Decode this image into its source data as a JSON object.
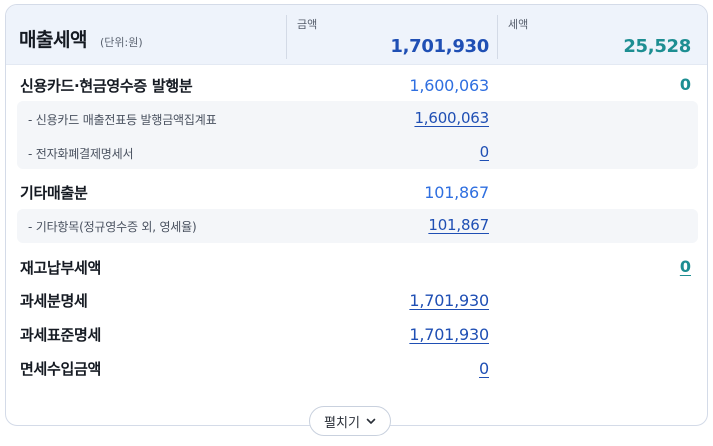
{
  "header": {
    "title": "매출세액",
    "unit": "(단위:원)",
    "amount_label": "금액",
    "amount_value": "1,701,930",
    "tax_label": "세액",
    "tax_value": "25,528"
  },
  "rows": {
    "card_cash": {
      "label": "신용카드·현금영수증 발행분",
      "amount": "1,600,063",
      "tax": "0"
    },
    "card_sub": {
      "label": "- 신용카드 매출전표등 발행금액집계표",
      "amount": "1,600,063"
    },
    "einvoice_sub": {
      "label": "- 전자화폐결제명세서",
      "amount": "0"
    },
    "other_sales": {
      "label": "기타매출분",
      "amount": "101,867"
    },
    "other_sub": {
      "label": "- 기타항목(정규영수증 외, 영세율)",
      "amount": "101,867"
    },
    "inventory_tax": {
      "label": "재고납부세액",
      "tax": "0"
    },
    "taxable_detail": {
      "label": "과세분명세",
      "amount": "1,701,930"
    },
    "standard_detail": {
      "label": "과세표준명세",
      "amount": "1,701,930"
    },
    "exempt_income": {
      "label": "면세수입금액",
      "amount": "0"
    }
  },
  "expand_button": {
    "label": "펼치기",
    "icon": "chevron-down-icon"
  },
  "colors": {
    "amount_blue": "#2f6fe0",
    "link_blue": "#1f4fb4",
    "tax_teal": "#1d8e92",
    "header_bg": "#eef3fb"
  }
}
